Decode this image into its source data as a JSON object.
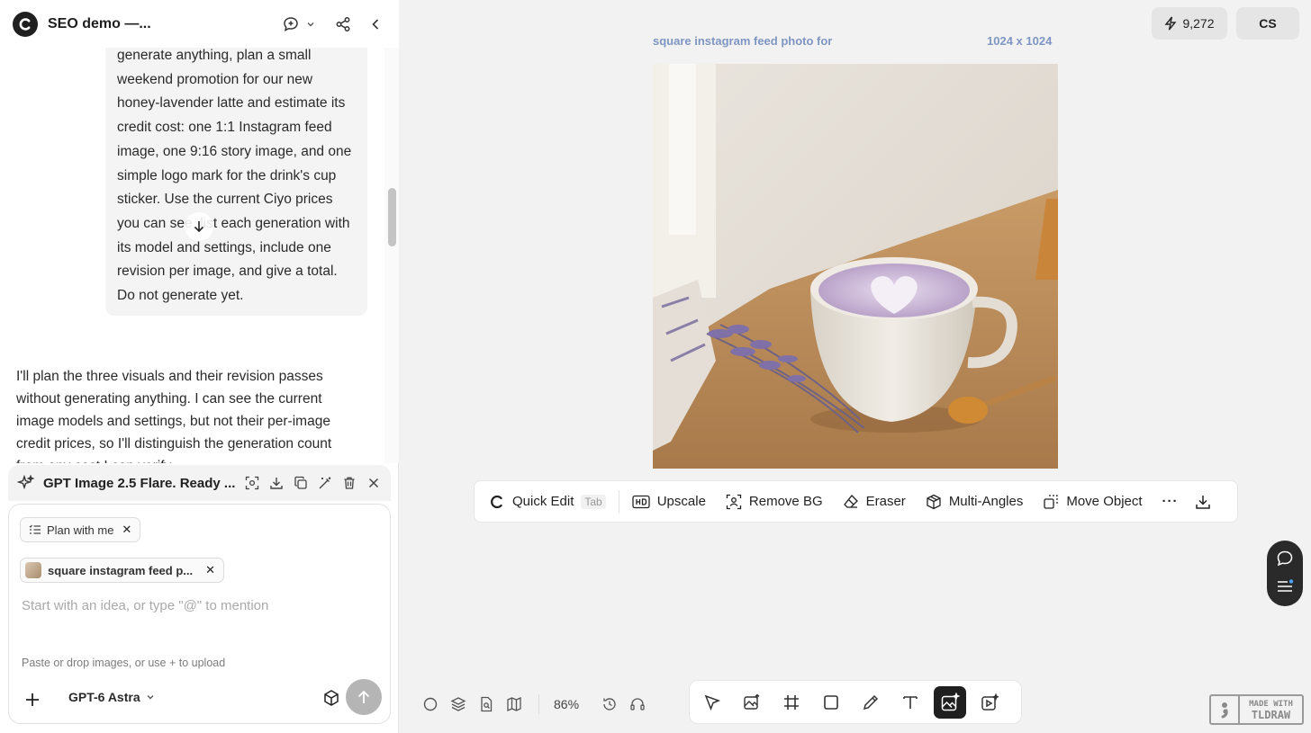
{
  "header": {
    "title": "SEO demo —..."
  },
  "chat": {
    "user_message": "generate anything, plan a small weekend promotion for our new honey-lavender latte and estimate its credit cost: one 1:1 Instagram feed image, one 9:16 story image, and one simple logo mark for the drink's cup sticker. Use the current Ciyo prices you can see, list each generation with its model and settings, include one revision per image, and give a total. Do not generate yet.",
    "assistant_message": "I'll plan the three visuals and their revision passes without generating anything. I can see the current image models and settings, but not their per-image credit prices, so I'll distinguish the generation count from any cost I can verify."
  },
  "notification": {
    "text": "GPT Image 2.5 Flare. Ready ..."
  },
  "composer": {
    "mode_chip": "Plan with me",
    "attachment_chip": "square instagram feed p...",
    "placeholder": "Start with an idea, or type \"@\" to mention",
    "hint": "Paste or drop images, or use + to upload",
    "model": "GPT-6 Astra"
  },
  "canvas": {
    "credits": "9,272",
    "user_initials": "CS",
    "image_label": "square instagram feed photo for",
    "image_size": "1024 x 1024",
    "zoom": "86%"
  },
  "edit_bar": {
    "quick_edit": "Quick Edit",
    "quick_edit_shortcut": "Tab",
    "upscale": "Upscale",
    "remove_bg": "Remove BG",
    "eraser": "Eraser",
    "multi_angles": "Multi-Angles",
    "move_object": "Move Object",
    "more": "···"
  },
  "watermark": {
    "line1": "MADE WITH",
    "line2": "TLDRAW"
  },
  "colors": {
    "accent_label": "#7e96c3",
    "active_tool": "#1f1f1f",
    "send_disabled": "#b5b5b5"
  }
}
